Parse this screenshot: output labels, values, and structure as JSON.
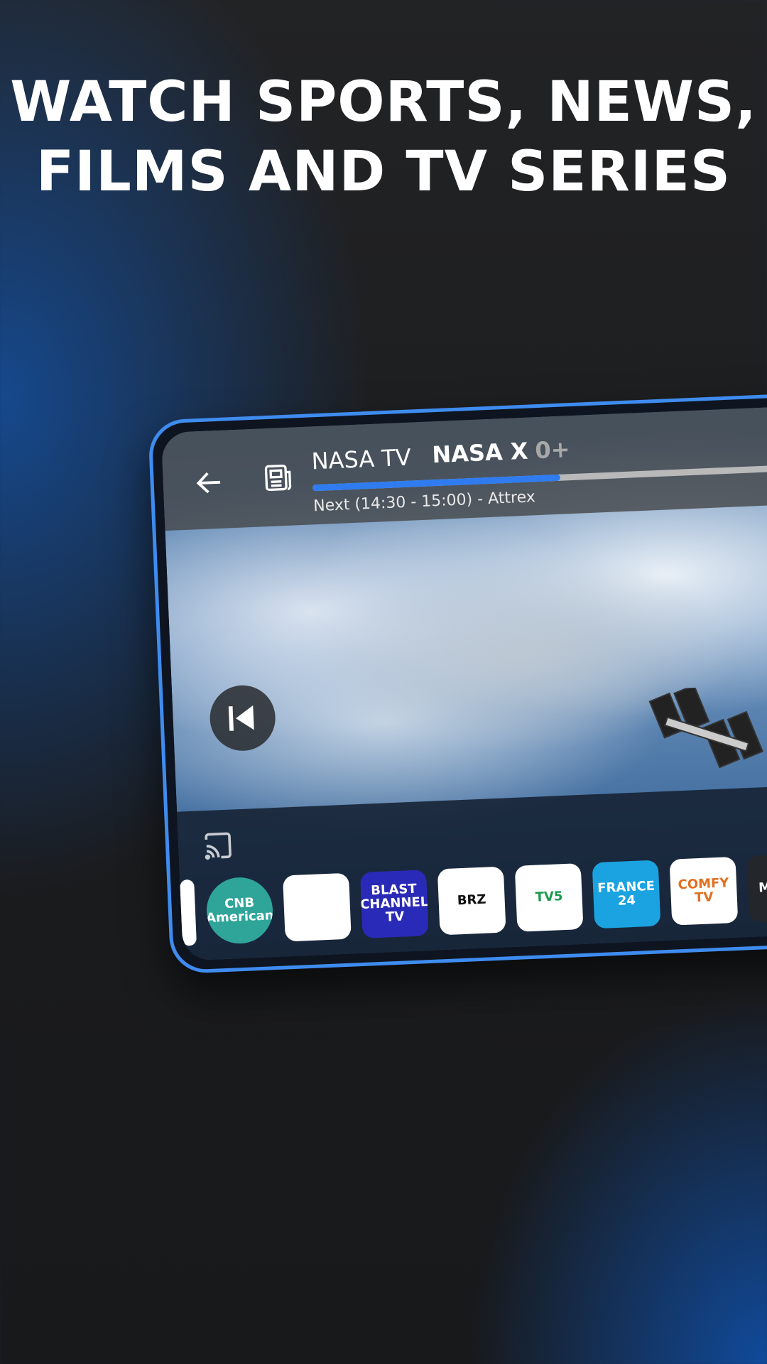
{
  "headline": {
    "line1": "WATCH SPORTS, NEWS,",
    "line2": "FILMS AND TV SERIES"
  },
  "player": {
    "channel_name": "NASA TV",
    "program_title": "NASA X",
    "age_rating": "0+",
    "progress": 0.4,
    "next_program": "Next (14:30 - 15:00) - Attrex",
    "icons": {
      "back": "arrow-left-icon",
      "guide": "newspaper-icon",
      "previous": "skip-previous-icon",
      "cast": "cast-icon"
    }
  },
  "channels": [
    {
      "name": "partial",
      "label": "",
      "bg": "#ffffff",
      "fg": "#e04020"
    },
    {
      "name": "cnb-american",
      "label": "CNB American",
      "bg": "#2fa59a",
      "fg": "#ffffff"
    },
    {
      "name": "world-flags",
      "label": "",
      "bg": "#ffffff",
      "fg": "#a07030"
    },
    {
      "name": "blast-channel-tv",
      "label": "BLAST CHANNEL TV",
      "bg": "#2a2ab8",
      "fg": "#ffffff"
    },
    {
      "name": "brz",
      "label": "BRZ",
      "bg": "#ffffff",
      "fg": "#111111"
    },
    {
      "name": "tv5",
      "label": "TV5",
      "bg": "#ffffff",
      "fg": "#1a9a4a"
    },
    {
      "name": "france-24",
      "label": "FRANCE 24",
      "bg": "#1aa3e0",
      "fg": "#ffffff"
    },
    {
      "name": "comfy-tv",
      "label": "COMFY TV",
      "bg": "#ffffff",
      "fg": "#e07020"
    },
    {
      "name": "my-home",
      "label": "My Ho",
      "bg": "#23262b",
      "fg": "#ffffff"
    }
  ],
  "colors": {
    "accent": "#2f7cf0",
    "frame": "#3f8cf0"
  }
}
